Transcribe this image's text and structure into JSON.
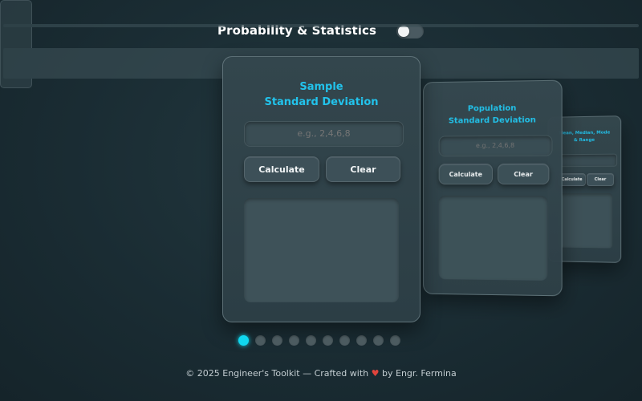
{
  "header": {
    "title": "Probability & Statistics"
  },
  "cards": [
    {
      "title_line1": "Sample",
      "title_line2": "Standard Deviation",
      "placeholder": "e.g., 2,4,6,8",
      "calculate": "Calculate",
      "clear": "Clear"
    },
    {
      "title_line1": "Population",
      "title_line2": "Standard Deviation",
      "placeholder": "e.g., 2,4,6,8",
      "calculate": "Calculate",
      "clear": "Clear"
    },
    {
      "title_line1": "Mean, Median, Mode",
      "title_line2": "& Range",
      "placeholder": "",
      "calculate": "Calculate",
      "clear": "Clear"
    }
  ],
  "pagination": {
    "count": 10,
    "active": 0
  },
  "footer": {
    "prefix": "© 2025 Engineer's Toolkit — Crafted with",
    "heart": "♥",
    "suffix": "by Engr. Fermina"
  },
  "colors": {
    "accent": "#22c3ec",
    "active_dot": "#10d8f0",
    "heart": "#e0443c"
  }
}
